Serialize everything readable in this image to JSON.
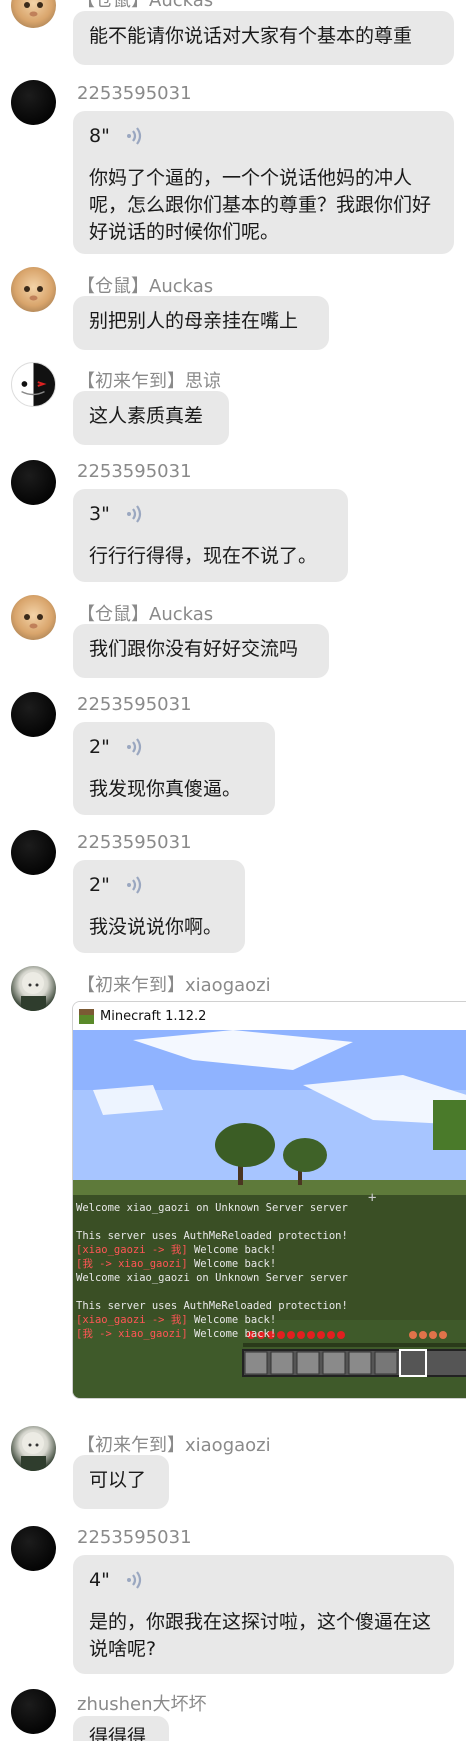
{
  "messages": [
    {
      "sender": "【仓鼠】Auckas",
      "text": "能不能请你说话对大家有个基本的尊重"
    },
    {
      "sender": "2253595031",
      "duration": "8\"",
      "text": "你妈了个逼的，一个个说话他妈的冲人呢，怎么跟你们基本的尊重？我跟你们好好说话的时候你们呢。"
    },
    {
      "sender": "【仓鼠】Auckas",
      "text": "别把别人的母亲挂在嘴上"
    },
    {
      "sender": "【初来乍到】思谅",
      "text": "这人素质真差"
    },
    {
      "sender": "2253595031",
      "duration": "3\"",
      "text": "行行行得得，现在不说了。"
    },
    {
      "sender": "【仓鼠】Auckas",
      "text": "我们跟你没有好好交流吗"
    },
    {
      "sender": "2253595031",
      "duration": "2\"",
      "text": "我发现你真傻逼。"
    },
    {
      "sender": "2253595031",
      "duration": "2\"",
      "text": "我没说说你啊。"
    },
    {
      "sender": "【初来乍到】xiaogaozi",
      "image": {
        "window_title": "Minecraft 1.12.2",
        "chat_lines": [
          {
            "text": "Welcome xiao_gaozi on Unknown Server server"
          },
          {
            "text": ""
          },
          {
            "text": "This server uses AuthMeReloaded protection!"
          },
          {
            "prefix": "[xiao_gaozi -> 我]",
            "text": " Welcome back!"
          },
          {
            "prefix": "[我 -> xiao_gaozi]",
            "text": " Welcome back!"
          },
          {
            "text": "Welcome xiao_gaozi on Unknown Server server"
          },
          {
            "text": ""
          },
          {
            "text": "This server uses AuthMeReloaded protection!"
          },
          {
            "prefix": "[xiao_gaozi -> 我]",
            "text": " Welcome back!"
          },
          {
            "prefix": "[我 -> xiao_gaozi]",
            "text": " Welcome back!"
          }
        ]
      }
    },
    {
      "sender": "【初来乍到】xiaogaozi",
      "text": "可以了"
    },
    {
      "sender": "2253595031",
      "duration": "4\"",
      "text": "是的，你跟我在这探讨啦，这个傻逼在这说啥呢?"
    },
    {
      "sender": "zhushen大坏坏",
      "text": "得得得"
    }
  ],
  "colors": {
    "bubble": "#e8e8e8",
    "name": "#8a8a8a",
    "voice_icon": "#9aa7c0",
    "mc_red": "#ff5555"
  },
  "icons": {
    "voice": "voice-wave-icon"
  }
}
